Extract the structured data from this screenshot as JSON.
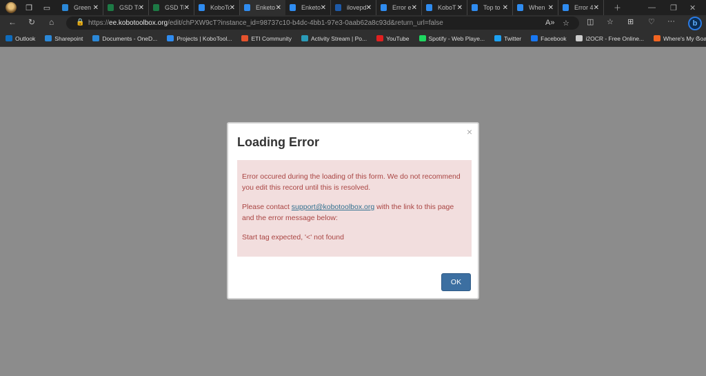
{
  "tabs": [
    {
      "label": "Green",
      "fav": "#2b88d8",
      "x": true
    },
    {
      "label": "GSD Tr",
      "fav": "#1d7a45",
      "x": true
    },
    {
      "label": "GSD Tr",
      "fav": "#1d7a45",
      "x": true
    },
    {
      "label": "KoboTo",
      "fav": "#2f8cf0",
      "x": true
    },
    {
      "label": "Enketo",
      "fav": "#2f8cf0",
      "x": true,
      "active": true
    },
    {
      "label": "Enketo",
      "fav": "#2f8cf0",
      "x": true
    },
    {
      "label": "ilovepdf",
      "fav": "#1e5aa8",
      "x": true
    },
    {
      "label": "Error e",
      "fav": "#2f8cf0",
      "x": true
    },
    {
      "label": "KoboT",
      "fav": "#2f8cf0",
      "x": true
    },
    {
      "label": "Top to",
      "fav": "#2f8cf0",
      "x": true
    },
    {
      "label": "When",
      "fav": "#2f8cf0",
      "x": true
    },
    {
      "label": "Error 4",
      "fav": "#2f8cf0",
      "x": true
    }
  ],
  "address": {
    "scheme": "https://",
    "host": "ee.kobotoolbox.org",
    "path": "/edit/chPXW9cT?instance_id=98737c10-b4dc-4bb1-97e3-0aab62a8c93d&return_url=false"
  },
  "bookmarks": [
    {
      "label": "Outlook",
      "color": "#0f6cbd"
    },
    {
      "label": "Sharepoint",
      "color": "#2b88d8"
    },
    {
      "label": "Documents - OneD...",
      "color": "#2b88d8"
    },
    {
      "label": "Projects | KoboTool...",
      "color": "#2f8cf0"
    },
    {
      "label": "ETI Community",
      "color": "#e5532d"
    },
    {
      "label": "Activity Stream | Po...",
      "color": "#2a9bb8"
    },
    {
      "label": "YouTube",
      "color": "#e02020"
    },
    {
      "label": "Spotify - Web Playe...",
      "color": "#1ed760"
    },
    {
      "label": "Twitter",
      "color": "#1da1f2"
    },
    {
      "label": "Facebook",
      "color": "#1877f2"
    },
    {
      "label": "i2OCR - Free Online...",
      "color": "#cccccc"
    },
    {
      "label": "Where's My Goat?...",
      "color": "#f26522"
    }
  ],
  "modal": {
    "title": "Loading Error",
    "close": "×",
    "p1": "Error occured during the loading of this form. We do not recommend you edit this record until this is resolved.",
    "p2_before": "Please contact ",
    "p2_link": "support@kobotoolbox.org",
    "p2_after": " with the link to this page and the error message below:",
    "error": "Start tag expected, '<' not found",
    "ok": "OK"
  }
}
